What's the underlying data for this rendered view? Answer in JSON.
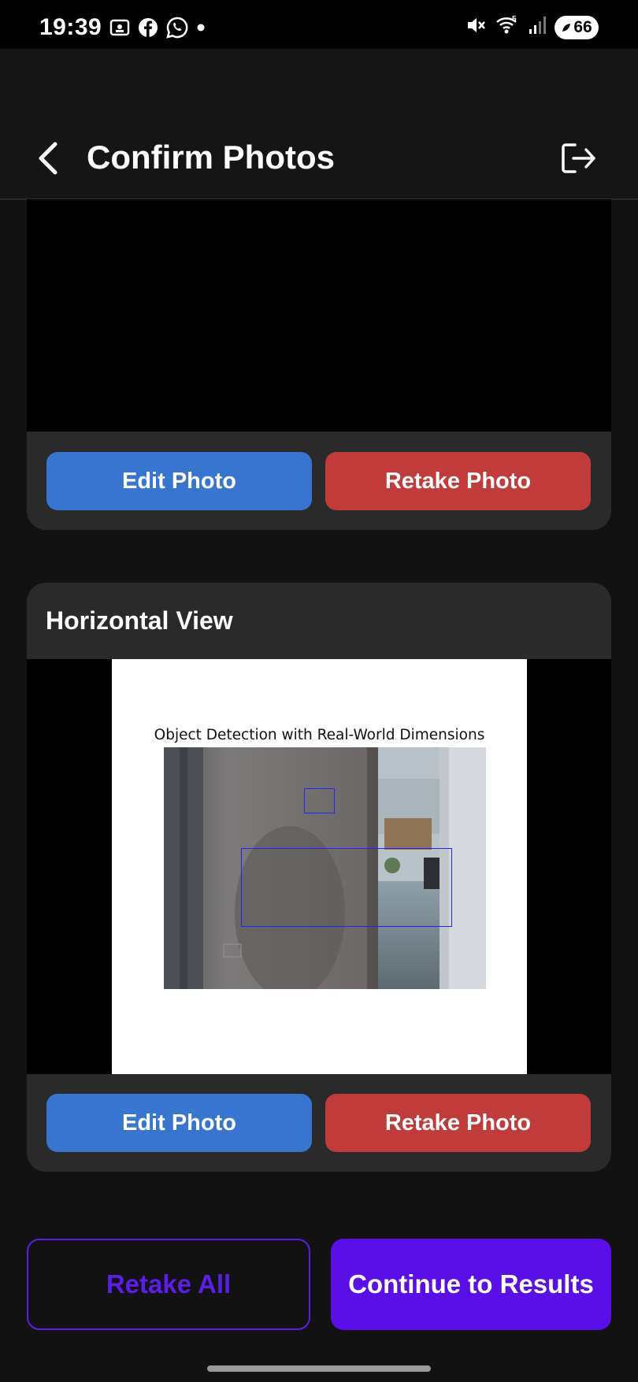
{
  "status_bar": {
    "time": "19:39",
    "battery": "66",
    "signal_label": "5",
    "left_icons": [
      "screenshot-icon",
      "facebook-icon",
      "whatsapp-icon",
      "dot-icon"
    ],
    "right_icons": [
      "mute-icon",
      "wifi-icon",
      "signal-icon",
      "battery-icon"
    ]
  },
  "header": {
    "title": "Confirm Photos",
    "back_icon": "chevron-left-icon",
    "logout_icon": "logout-icon"
  },
  "photo_cards": [
    {
      "title": "",
      "edit_label": "Edit Photo",
      "retake_label": "Retake Photo"
    },
    {
      "title": "Horizontal View",
      "image_title": "Object Detection with Real-World Dimensions",
      "edit_label": "Edit Photo",
      "retake_label": "Retake Photo"
    }
  ],
  "footer": {
    "retake_all_label": "Retake All",
    "continue_label": "Continue to Results"
  },
  "colors": {
    "edit_button": "#3875d0",
    "retake_button": "#c23b3b",
    "primary": "#5b0fe8",
    "card": "#2a2a2a",
    "background": "#121212"
  }
}
